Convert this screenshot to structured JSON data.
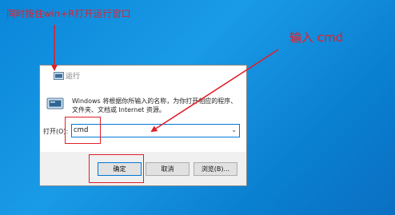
{
  "annotations": {
    "top": "同时按住win+R打开运行窗口",
    "right": "输入 cmd"
  },
  "dialog": {
    "title": "运行",
    "description": "Windows 将根据你所输入的名称，为你打开相应的程序、文件夹、文档或 Internet 资源。",
    "open_label": "打开(O):",
    "open_value": "cmd",
    "buttons": {
      "ok": "确定",
      "cancel": "取消",
      "browse": "浏览(B)..."
    }
  },
  "colors": {
    "annotation": "#e0202a",
    "desktop": "#0a86d9",
    "focus_border": "#0078d7"
  },
  "icons": {
    "title": "run-icon",
    "app": "run-icon",
    "dropdown": "chevron-down-icon"
  }
}
